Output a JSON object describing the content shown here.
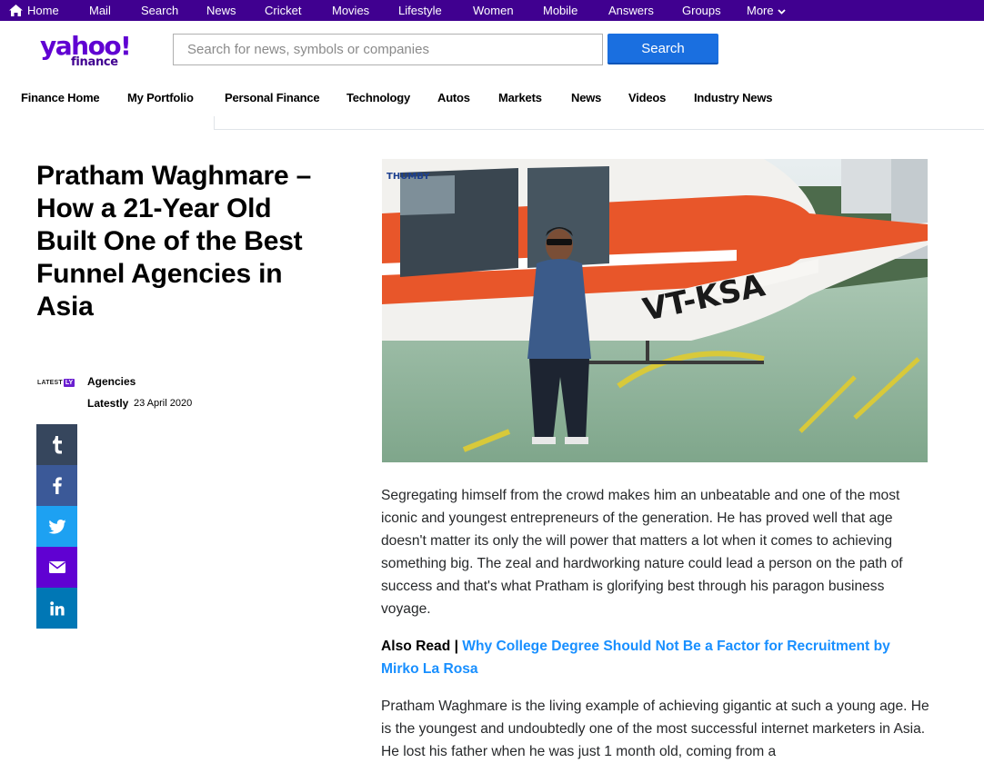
{
  "topbar": {
    "items": [
      "Home",
      "Mail",
      "Search",
      "News",
      "Cricket",
      "Movies",
      "Lifestyle",
      "Women",
      "Mobile",
      "Answers",
      "Groups",
      "More"
    ]
  },
  "header": {
    "logo_main": "yahoo!",
    "logo_sub": "finance",
    "search_placeholder": "Search for news, symbols or companies",
    "search_button": "Search"
  },
  "nav": {
    "tabs": [
      "Finance Home",
      "My Portfolio",
      "Personal Finance",
      "Technology",
      "Autos",
      "Markets",
      "News",
      "Videos",
      "Industry News"
    ]
  },
  "article": {
    "title": "Pratham Waghmare – How a 21-Year Old Built One of the Best Funnel Agencies in Asia",
    "provider_logo": {
      "text": "LATEST",
      "badge": "LY"
    },
    "category": "Agencies",
    "author": "Latestly",
    "date": "23 April 2020",
    "hero_text": {
      "brand": "THUMBY",
      "registration": "VT-KSA"
    },
    "paragraph1": "Segregating himself from the crowd makes him an unbeatable and one of the most iconic and youngest entrepreneurs of the generation. He has proved well that age doesn't matter its only the will power that matters a lot when it comes to achieving something big. The zeal and hardworking nature could lead a person on the path of success and that's what Pratham is glorifying best through his paragon business voyage.",
    "also_read_label": "Also Read |",
    "also_read_link": "Why College Degree Should Not Be a Factor for Recruitment by Mirko La Rosa",
    "paragraph2": "Pratham Waghmare is the living example of achieving gigantic at such a young age. He is the youngest and undoubtedly one of the most successful internet marketers in Asia. He lost his father when he was just 1 month old, coming from a"
  },
  "share": [
    "tumblr-icon",
    "facebook-icon",
    "twitter-icon",
    "mail-icon",
    "linkedin-icon"
  ],
  "colors": {
    "topbar": "#400090",
    "brand": "#6001d2",
    "search_button": "#1a6fe0",
    "link": "#188fff"
  }
}
